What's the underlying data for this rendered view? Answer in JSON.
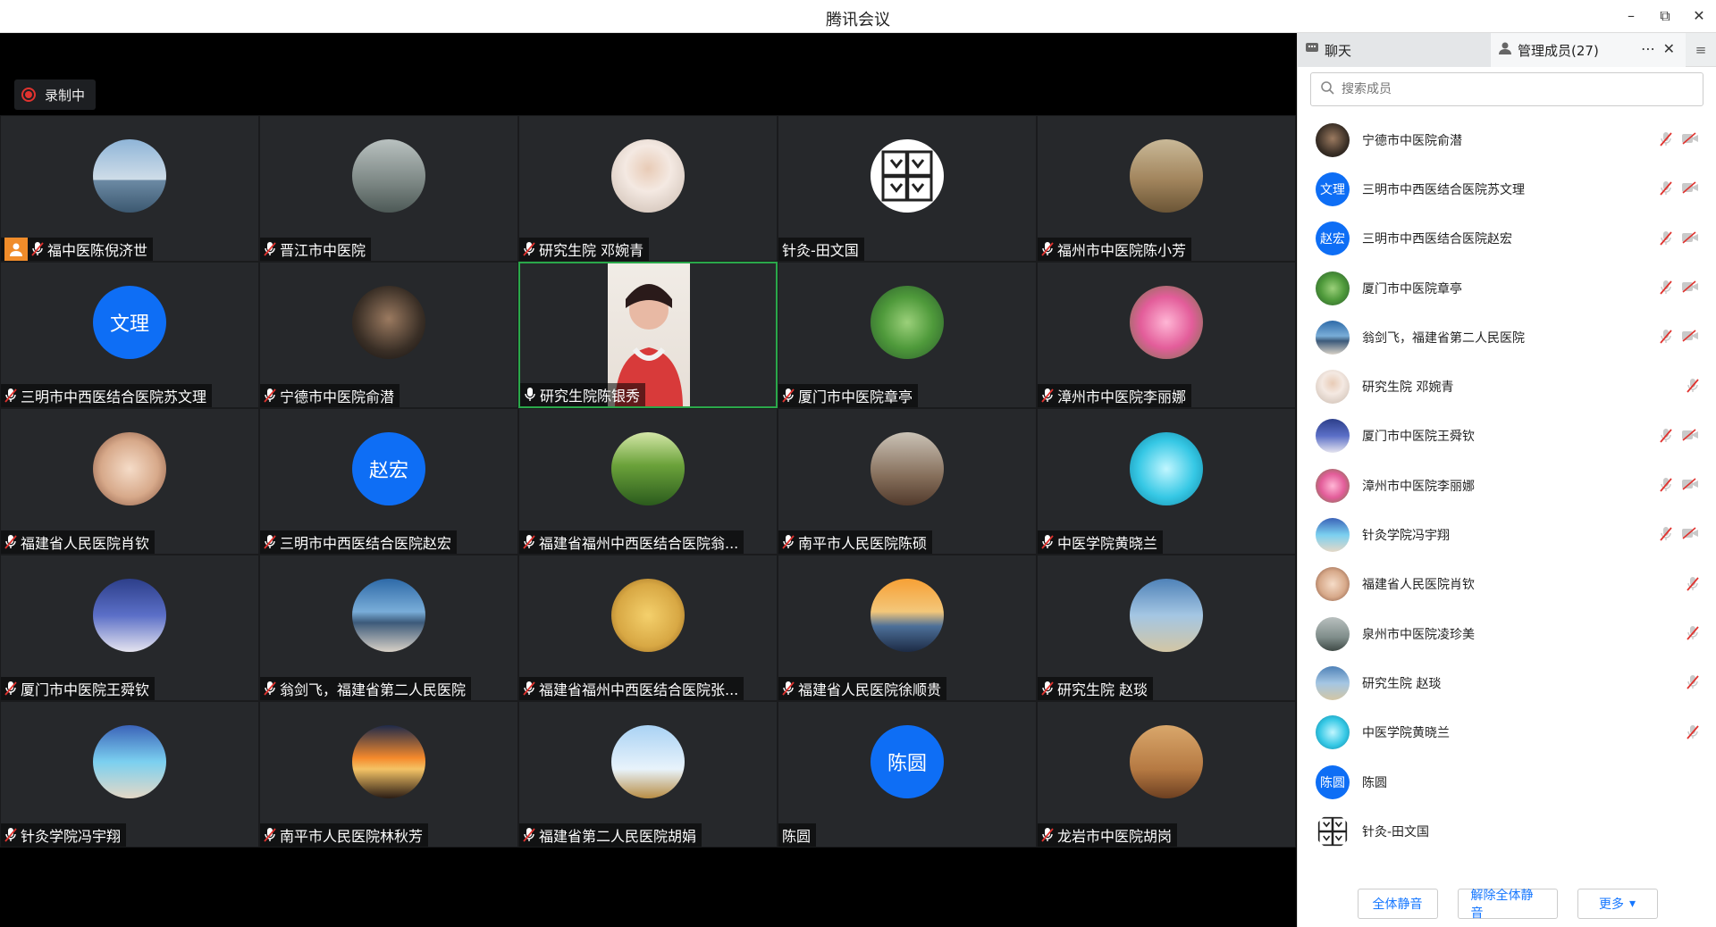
{
  "window": {
    "title": "腾讯会议",
    "controls": [
      "minimize-icon",
      "restore-icon",
      "close-icon"
    ]
  },
  "recording": {
    "label": "录制中",
    "color": "#e0332f"
  },
  "tiles": [
    {
      "name": "福中医陈倪济世",
      "avatar": "photo-person-icon",
      "host": true,
      "muted": true
    },
    {
      "name": "晋江市中医院",
      "avatar": "photo-statue-icon",
      "muted": true
    },
    {
      "name": "研究生院 邓婉青",
      "avatar": "photo-woman-icon",
      "muted": true
    },
    {
      "name": "针灸-田文国",
      "avatar": "photo-symbol-icon",
      "muted": false
    },
    {
      "name": "福州市中医院陈小芳",
      "avatar": "photo-deer-icon",
      "muted": true
    },
    {
      "name": "三明市中西医结合医院苏文理",
      "avatar_text": "文理",
      "muted": true
    },
    {
      "name": "宁德市中医院俞潜",
      "avatar": "photo-man-icon",
      "muted": true
    },
    {
      "name": "研究生院陈银秀",
      "avatar": "video-feed",
      "active": true,
      "muted": false
    },
    {
      "name": "厦门市中医院章亭",
      "avatar": "photo-cactus-icon",
      "muted": true
    },
    {
      "name": "漳州市中医院李丽娜",
      "avatar": "photo-rose-icon",
      "muted": true
    },
    {
      "name": "福建省人民医院肖钦",
      "avatar": "photo-girl-icon",
      "muted": true
    },
    {
      "name": "三明市中西医结合医院赵宏",
      "avatar_text": "赵宏",
      "muted": true
    },
    {
      "name": "福建省福州中西医结合医院翁...",
      "avatar": "photo-hills-icon",
      "muted": true
    },
    {
      "name": "南平市人民医院陈硕",
      "avatar": "photo-group-icon",
      "muted": true
    },
    {
      "name": "中医学院黄晓兰",
      "avatar": "photo-music-icon",
      "muted": true
    },
    {
      "name": "厦门市中医院王舜钦",
      "avatar": "photo-couple-icon",
      "muted": true
    },
    {
      "name": "翁剑飞，福建省第二人民医院",
      "avatar": "photo-sea-icon",
      "muted": true
    },
    {
      "name": "福建省福州中西医结合医院张...",
      "avatar": "photo-man-glasses-icon",
      "muted": true
    },
    {
      "name": "福建省人民医院徐顺贵",
      "avatar": "photo-sunset-icon",
      "muted": true
    },
    {
      "name": "研究生院 赵琰",
      "avatar": "photo-beach-icon",
      "muted": true
    },
    {
      "name": "针灸学院冯宇翔",
      "avatar": "photo-cartoon-icon",
      "muted": true
    },
    {
      "name": "南平市人民医院林秋芳",
      "avatar": "photo-sunset2-icon",
      "muted": true
    },
    {
      "name": "福建省第二人民医院胡娟",
      "avatar": "photo-bike-icon",
      "muted": true
    },
    {
      "name": "陈圆",
      "avatar_text": "陈圆",
      "muted": false
    },
    {
      "name": "龙岩市中医院胡岗",
      "avatar": "photo-family-icon",
      "muted": true
    }
  ],
  "side": {
    "tabs": [
      {
        "label": "聊天"
      },
      {
        "label": "管理成员(27)"
      }
    ],
    "search_placeholder": "搜索成员",
    "members": [
      {
        "name": "宁德市中医院俞潜",
        "avatar": "photo-man-icon",
        "mic_off": true,
        "cam_off": true
      },
      {
        "name": "三明市中西医结合医院苏文理",
        "avatar_text": "文理",
        "mic_off": true,
        "cam_off": true
      },
      {
        "name": "三明市中西医结合医院赵宏",
        "avatar_text": "赵宏",
        "mic_off": true,
        "cam_off": true
      },
      {
        "name": "厦门市中医院章亭",
        "avatar": "photo-cactus-icon",
        "mic_off": true,
        "cam_off": true
      },
      {
        "name": "翁剑飞，福建省第二人民医院",
        "avatar": "photo-sea-icon",
        "mic_off": true,
        "cam_off": true
      },
      {
        "name": "研究生院 邓婉青",
        "avatar": "photo-woman-icon",
        "mic_off": true,
        "cam_off": false
      },
      {
        "name": "厦门市中医院王舜钦",
        "avatar": "photo-couple-icon",
        "mic_off": true,
        "cam_off": true
      },
      {
        "name": "漳州市中医院李丽娜",
        "avatar": "photo-rose-icon",
        "mic_off": true,
        "cam_off": true
      },
      {
        "name": "针灸学院冯宇翔",
        "avatar": "photo-cartoon-icon",
        "mic_off": true,
        "cam_off": true
      },
      {
        "name": "福建省人民医院肖钦",
        "avatar": "photo-girl-icon",
        "mic_off": true,
        "cam_off": false
      },
      {
        "name": "泉州市中医院凌珍美",
        "avatar": "photo-landscape-icon",
        "mic_off": true,
        "cam_off": false
      },
      {
        "name": "研究生院 赵琰",
        "avatar": "photo-beach-icon",
        "mic_off": true,
        "cam_off": false
      },
      {
        "name": "中医学院黄晓兰",
        "avatar": "photo-music-icon",
        "mic_off": true,
        "cam_off": false
      },
      {
        "name": "陈圆",
        "avatar_text": "陈圆",
        "mic_off": false,
        "cam_off": false
      },
      {
        "name": "针灸-田文国",
        "avatar": "photo-symbol-icon",
        "mic_off": false,
        "cam_off": false
      }
    ],
    "footer": {
      "mute_all": "全体静音",
      "unmute_all": "解除全体静音",
      "more": "更多"
    }
  },
  "colors": {
    "accent": "#0e6ef5",
    "active_border": "#2aa84a",
    "muted_red": "#e0332f"
  }
}
